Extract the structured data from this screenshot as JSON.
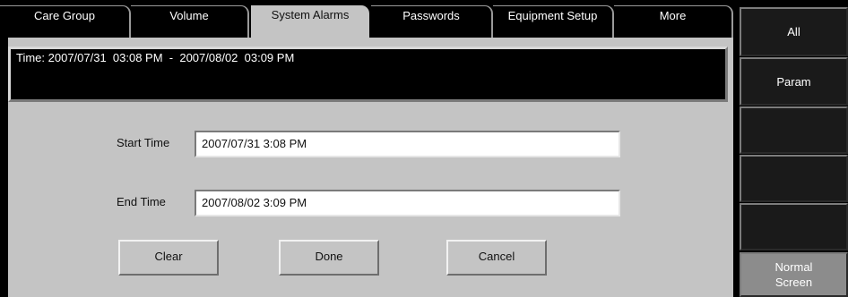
{
  "tabs": [
    {
      "label": "Care Group",
      "active": false
    },
    {
      "label": "Volume",
      "active": false
    },
    {
      "label": "System Alarms",
      "active": true
    },
    {
      "label": "Passwords",
      "active": false
    },
    {
      "label": "Equipment Setup",
      "active": false
    },
    {
      "label": "More",
      "active": false
    }
  ],
  "time_range": "Time: 2007/07/31  03:08 PM  -  2007/08/02  03:09 PM",
  "form": {
    "start_label": "Start Time",
    "start_value": "2007/07/31  3:08 PM",
    "end_label": "End Time",
    "end_value": "2007/08/02  3:09 PM"
  },
  "buttons": {
    "clear": "Clear",
    "done": "Done",
    "cancel": "Cancel"
  },
  "side_menu": {
    "all": "All",
    "param": "Param",
    "blank1": "",
    "blank2": "",
    "blank3": "",
    "normal_line1": "Normal",
    "normal_line2": "Screen"
  }
}
